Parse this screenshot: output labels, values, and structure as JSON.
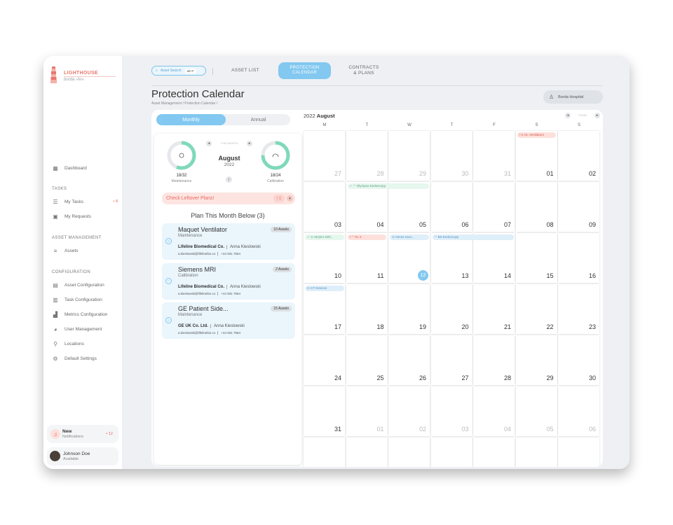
{
  "sidebar": {
    "logo_title": "LIGHTHOUSE",
    "logo_sub": "borda ›Ai∞",
    "dashboard": "Dashboard",
    "tasks_section": "TASKS",
    "my_tasks": "My Tasks",
    "my_tasks_count": "• 8",
    "my_requests": "My Requests",
    "asset_mgmt_section": "ASSET MANAGEMENT",
    "assets": "Assets",
    "config_section": "CONFIGURATION",
    "asset_configuration": "Asset Configuration",
    "task_configuration": "Task Configuration",
    "metrics_configuration": "Metrics Configuration",
    "user_management": "User Management",
    "locations": "Locations",
    "default_settings": "Default Settings",
    "notif_title": "New",
    "notif_sub": "Notifications",
    "notif_count": "• 12",
    "user_name": "Johnson Doe",
    "user_status": "Available"
  },
  "topbar": {
    "search_label": "Asset Search",
    "search_kbd": "alt+F",
    "tab_asset_list": "ASSET LIST",
    "tab_protection_calendar": "PROTECTION CALENDAR",
    "tab_contracts_plans": "CONTRACTS & PLANS"
  },
  "page": {
    "title": "Protection Calendar",
    "breadcrumb": "Asset Management  /  Protection Calendar  /",
    "hospital": "Borda Hospital"
  },
  "panel": {
    "toggle_monthly": "Monthly",
    "toggle_annual": "Annual",
    "this_month": "THIS MONTH",
    "month": "August",
    "year": "2022",
    "maintenance_value": "18/32",
    "maintenance_label": "Maintenance",
    "maintenance_fraction": 0.5625,
    "calibration_value": "18/24",
    "calibration_label": "Calibration",
    "calibration_fraction": 0.75,
    "leftover": "Check Leftover Plans!",
    "leftover_count": "! 1",
    "plan_heading": "Plan This Month Below (3)",
    "cards": [
      {
        "name": "Maquet Ventilator",
        "type": "Maintenance",
        "assets": "10 Assets",
        "company": "Lifeline Biomedical Co.",
        "person": "Anna Kieslowski",
        "email": "a.kieslowski@lifelinebio.co",
        "phone": "+44 931 7664"
      },
      {
        "name": "Siemens MRI",
        "type": "Calibration",
        "assets": "2 Assets",
        "company": "Lifeline Biomedical Co.",
        "person": "Anna Kieslowski",
        "email": "a.kieslowski@lifelinebio.co",
        "phone": "+44 931 7664"
      },
      {
        "name": "GE Patient Side...",
        "type": "Maintenance",
        "assets": "15 Assets",
        "company": "GE UK Co. Ltd.",
        "person": "Anna Kieslowski",
        "email": "a.kieslowski@lifelinebio.co",
        "phone": "+44 931 7664"
      }
    ]
  },
  "calendar": {
    "year": "2022",
    "month": "August",
    "nav_label": "TODAY",
    "days_of_week": [
      "M",
      "T",
      "W",
      "T",
      "F",
      "S",
      "S"
    ],
    "rows": [
      [
        {
          "d": "27",
          "dim": true
        },
        {
          "d": "28",
          "dim": true
        },
        {
          "d": "29",
          "dim": true
        },
        {
          "d": "30",
          "dim": true
        },
        {
          "d": "31",
          "dim": true
        },
        {
          "d": "01"
        },
        {
          "d": "02"
        }
      ],
      [
        {
          "d": "03"
        },
        {
          "d": "04"
        },
        {
          "d": "05"
        },
        {
          "d": "06"
        },
        {
          "d": "07"
        },
        {
          "d": "08"
        },
        {
          "d": "09"
        }
      ],
      [
        {
          "d": "10"
        },
        {
          "d": "11"
        },
        {
          "d": "12",
          "today": true
        },
        {
          "d": "13"
        },
        {
          "d": "14"
        },
        {
          "d": "15"
        },
        {
          "d": "16"
        }
      ],
      [
        {
          "d": "17"
        },
        {
          "d": "18"
        },
        {
          "d": "19"
        },
        {
          "d": "20"
        },
        {
          "d": "21"
        },
        {
          "d": "22"
        },
        {
          "d": "23"
        }
      ],
      [
        {
          "d": "24"
        },
        {
          "d": "25"
        },
        {
          "d": "26"
        },
        {
          "d": "27"
        },
        {
          "d": "28"
        },
        {
          "d": "29"
        },
        {
          "d": "30"
        }
      ],
      [
        {
          "d": "31"
        },
        {
          "d": "01",
          "dim": true
        },
        {
          "d": "02",
          "dim": true
        },
        {
          "d": "03",
          "dim": true
        },
        {
          "d": "04",
          "dim": true
        },
        {
          "d": "05",
          "dim": true
        },
        {
          "d": "06",
          "dim": true
        }
      ]
    ],
    "events": [
      {
        "label": "! ⊙ HL Ventilators",
        "color": "red",
        "row": 0,
        "col": 5,
        "span": 1
      },
      {
        "label": "✓ ◠ Olympus Endoscopy",
        "color": "green",
        "row": 1,
        "col": 1,
        "span": 2
      },
      {
        "label": "✓ ⊙ Stryker Defi...",
        "color": "green",
        "row": 2,
        "col": 0,
        "span": 1
      },
      {
        "label": "! ◠ HL 2",
        "color": "red",
        "row": 2,
        "col": 1,
        "span": 1
      },
      {
        "label": "⊙ Atmos Suct...",
        "color": "blue",
        "row": 2,
        "col": 2,
        "span": 1
      },
      {
        "label": "◠ BS Endoscopy",
        "color": "blue",
        "row": 2,
        "col": 3,
        "span": 2
      },
      {
        "label": "⊙ CT Devices",
        "color": "blue",
        "row": 3,
        "col": 0,
        "span": 1
      }
    ]
  },
  "colors": {
    "accent": "#82c8f0",
    "gauge": "#7fd9bb",
    "alert": "#e86a5e"
  }
}
